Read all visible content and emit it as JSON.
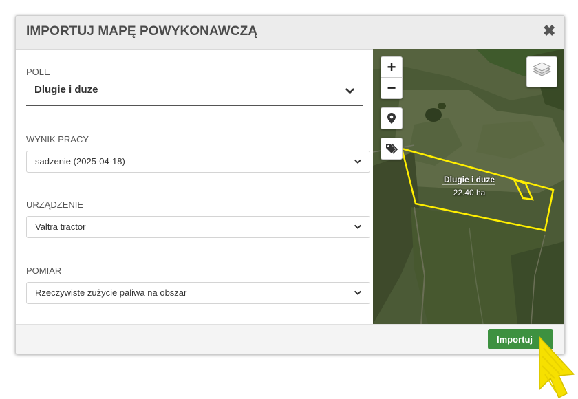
{
  "modal": {
    "title": "IMPORTUJ MAPĘ POWYKONAWCZĄ",
    "close_icon": "✖"
  },
  "form": {
    "field": {
      "label": "POLE",
      "value": "Dlugie i duze"
    },
    "work_result": {
      "label": "WYNIK PRACY",
      "value": "sadzenie (2025-04-18)"
    },
    "device": {
      "label": "URZĄDZENIE",
      "value": "Valtra tractor"
    },
    "measurement": {
      "label": "POMIAR",
      "value": "Rzeczywiste zużycie paliwa na obszar"
    }
  },
  "map": {
    "zoom_in_label": "+",
    "zoom_out_label": "−",
    "field_name": "Dlugie i duze",
    "field_area": "22.40 ha",
    "boundary_color": "#ffee00"
  },
  "footer": {
    "import_label": "Importuj"
  },
  "colors": {
    "accent": "#3d9140",
    "cursor": "#f6e000"
  }
}
